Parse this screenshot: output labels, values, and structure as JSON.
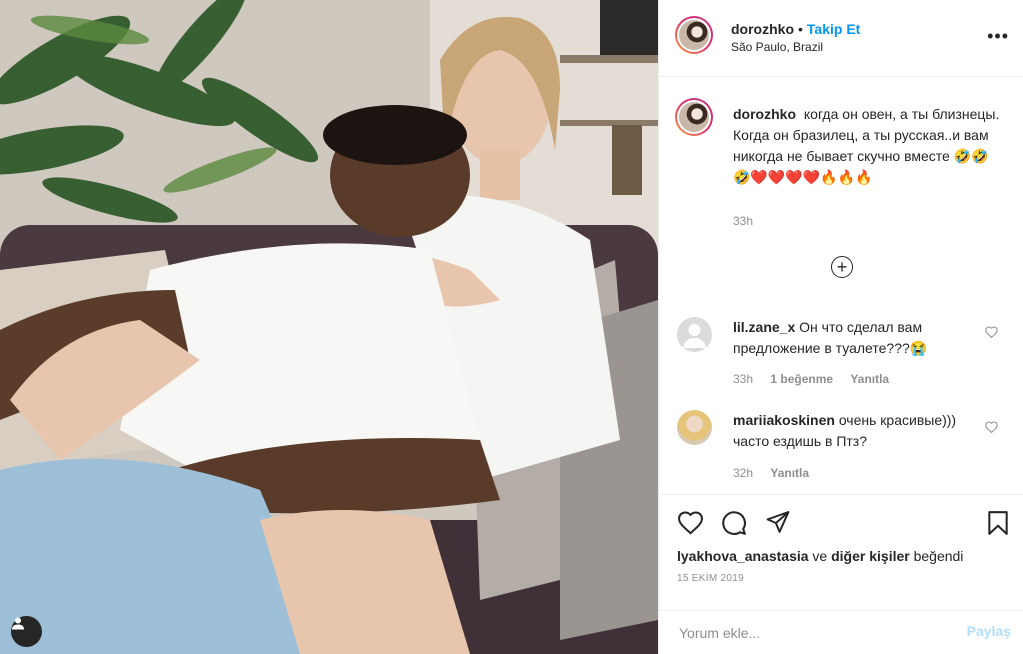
{
  "post": {
    "username": "dorozhko",
    "follow_label": "Takip Et",
    "separator": "•",
    "location": "São Paulo, Brazil",
    "more_label": "•••"
  },
  "caption": {
    "username": "dorozhko",
    "text": "когда он овен, а ты близнецы. Когда он бразилец, а ты русская..и вам никогда не бывает скучно вместе 🤣🤣🤣❤️❤️❤️❤️🔥🔥🔥",
    "time": "33h"
  },
  "load_more_label": "+",
  "comments": [
    {
      "username": "lil.zane_x",
      "text": "Он что сделал вам предложение в туалете???😭",
      "time": "33h",
      "likes": "1 beğenme",
      "reply": "Yanıtla"
    },
    {
      "username": "mariiakoskinen",
      "text": "очень красивые))) часто ездишь в Птз?",
      "time": "32h",
      "reply": "Yanıtla"
    }
  ],
  "likes": {
    "user": "lyakhova_anastasia",
    "connector": "ve",
    "others": "diğer kişiler",
    "suffix": "beğendi"
  },
  "date": "15 EKİM 2019",
  "comment_input": {
    "placeholder": "Yorum ekle...",
    "submit_label": "Paylaş"
  },
  "colors": {
    "accent": "#0095f6",
    "muted": "#8e8e8e",
    "submit_disabled": "#b2dffc",
    "divider": "#efefef"
  },
  "icons": [
    "heart-icon",
    "comment-icon",
    "share-icon",
    "bookmark-icon",
    "user-icon",
    "more-icon"
  ]
}
